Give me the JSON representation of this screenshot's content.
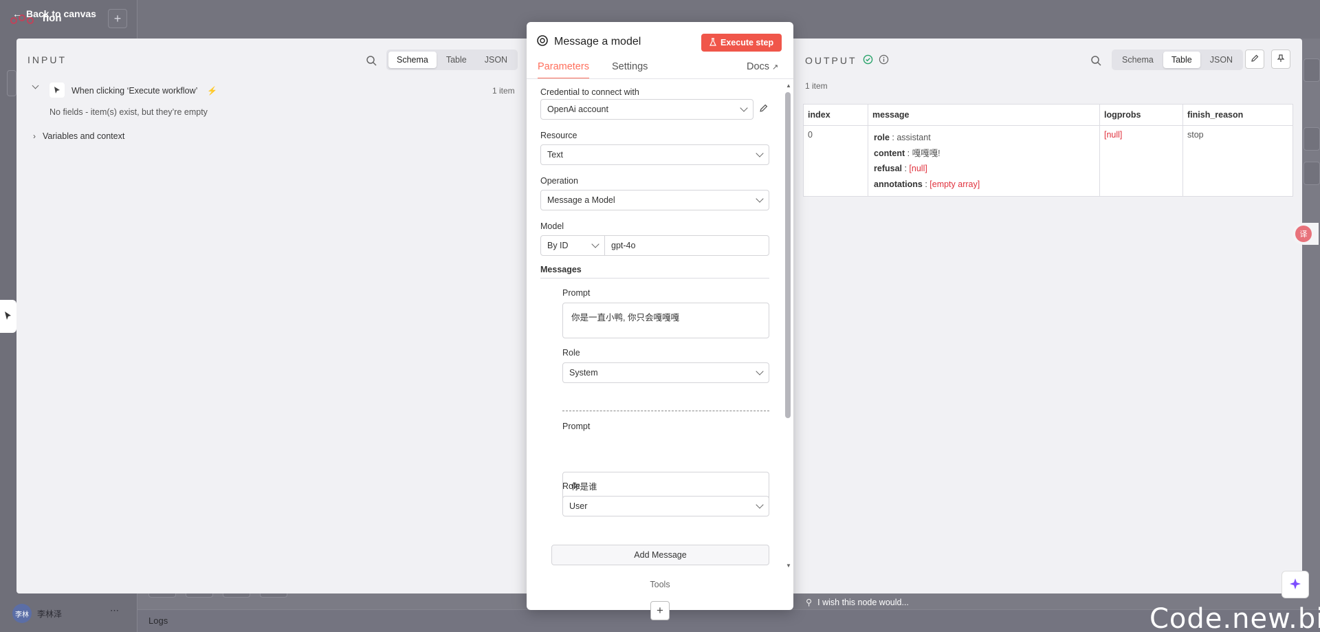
{
  "nav": {
    "back_label": "Back to canvas",
    "bg_title": "hon",
    "user_name": "李林泽",
    "logs_label": "Logs"
  },
  "input": {
    "title": "INPUT",
    "tabs": [
      "Schema",
      "Table",
      "JSON"
    ],
    "active_tab": "Schema",
    "trigger_name": "When clicking ‘Execute workflow’",
    "item_count": "1 item",
    "empty_message": "No fields - item(s) exist, but they’re empty",
    "variables_label": "Variables and context"
  },
  "node": {
    "title": "Message a model",
    "execute_label": "Execute step",
    "tabs": [
      "Parameters",
      "Settings"
    ],
    "active_tab": "Parameters",
    "docs_label": "Docs",
    "credential_label": "Credential to connect with",
    "credential_value": "OpenAi account",
    "resource_label": "Resource",
    "resource_value": "Text",
    "operation_label": "Operation",
    "operation_value": "Message a Model",
    "model_label": "Model",
    "model_mode": "By ID",
    "model_value": "gpt-4o",
    "messages_label": "Messages",
    "messages": [
      {
        "prompt_label": "Prompt",
        "prompt": "你是一直小鸭, 你只会嘎嘎嘎",
        "role_label": "Role",
        "role": "System"
      },
      {
        "prompt_label": "Prompt",
        "prompt": "你是谁",
        "role_label": "Role",
        "role": "User"
      }
    ],
    "add_message_label": "Add Message",
    "tools_label": "Tools",
    "add_label": "+"
  },
  "output": {
    "title": "OUTPUT",
    "tabs": [
      "Schema",
      "Table",
      "JSON"
    ],
    "active_tab": "Table",
    "item_count": "1 item",
    "columns": [
      "index",
      "message",
      "logprobs",
      "finish_reason"
    ],
    "row": {
      "index": "0",
      "message": [
        {
          "key": "role",
          "value": "assistant"
        },
        {
          "key": "content",
          "value": "嘎嘎嘎!"
        },
        {
          "key": "refusal",
          "value": "[null]"
        },
        {
          "key": "annotations",
          "value": "[empty array]"
        }
      ],
      "logprobs": "[null]",
      "finish_reason": "stop"
    },
    "feedback": "I wish this node would..."
  },
  "watermark": "Code.new.bi",
  "colors": {
    "accent": "#ff6f5c",
    "execute_bg": "#f0564a",
    "success": "#29a36a",
    "null_red": "#e0303c",
    "ai_icon": "#7c4dff"
  }
}
